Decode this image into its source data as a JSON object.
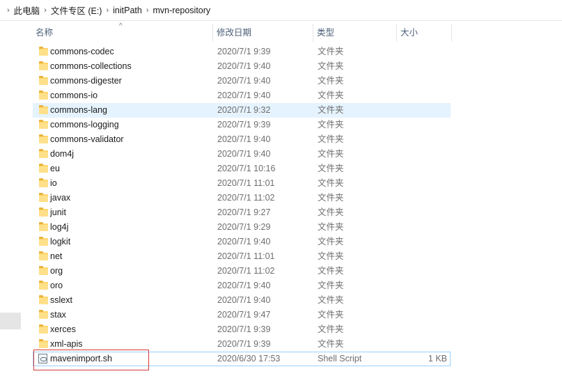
{
  "breadcrumb": [
    "此电脑",
    "文件专区 (E:)",
    "initPath",
    "mvn-repository"
  ],
  "columns": {
    "name": "名称",
    "date": "修改日期",
    "type": "类型",
    "size": "大小"
  },
  "rows": [
    {
      "name": "commons-codec",
      "date": "2020/7/1 9:39",
      "type": "文件夹",
      "size": "",
      "icon": "folder-icon"
    },
    {
      "name": "commons-collections",
      "date": "2020/7/1 9:40",
      "type": "文件夹",
      "size": "",
      "icon": "folder-icon"
    },
    {
      "name": "commons-digester",
      "date": "2020/7/1 9:40",
      "type": "文件夹",
      "size": "",
      "icon": "folder-icon"
    },
    {
      "name": "commons-io",
      "date": "2020/7/1 9:40",
      "type": "文件夹",
      "size": "",
      "icon": "folder-icon"
    },
    {
      "name": "commons-lang",
      "date": "2020/7/1 9:32",
      "type": "文件夹",
      "size": "",
      "icon": "folder-icon"
    },
    {
      "name": "commons-logging",
      "date": "2020/7/1 9:39",
      "type": "文件夹",
      "size": "",
      "icon": "folder-icon"
    },
    {
      "name": "commons-validator",
      "date": "2020/7/1 9:40",
      "type": "文件夹",
      "size": "",
      "icon": "folder-icon"
    },
    {
      "name": "dom4j",
      "date": "2020/7/1 9:40",
      "type": "文件夹",
      "size": "",
      "icon": "folder-icon"
    },
    {
      "name": "eu",
      "date": "2020/7/1 10:16",
      "type": "文件夹",
      "size": "",
      "icon": "folder-icon"
    },
    {
      "name": "io",
      "date": "2020/7/1 11:01",
      "type": "文件夹",
      "size": "",
      "icon": "folder-icon"
    },
    {
      "name": "javax",
      "date": "2020/7/1 11:02",
      "type": "文件夹",
      "size": "",
      "icon": "folder-icon"
    },
    {
      "name": "junit",
      "date": "2020/7/1 9:27",
      "type": "文件夹",
      "size": "",
      "icon": "folder-icon"
    },
    {
      "name": "log4j",
      "date": "2020/7/1 9:29",
      "type": "文件夹",
      "size": "",
      "icon": "folder-icon"
    },
    {
      "name": "logkit",
      "date": "2020/7/1 9:40",
      "type": "文件夹",
      "size": "",
      "icon": "folder-icon"
    },
    {
      "name": "net",
      "date": "2020/7/1 11:01",
      "type": "文件夹",
      "size": "",
      "icon": "folder-icon"
    },
    {
      "name": "org",
      "date": "2020/7/1 11:02",
      "type": "文件夹",
      "size": "",
      "icon": "folder-icon"
    },
    {
      "name": "oro",
      "date": "2020/7/1 9:40",
      "type": "文件夹",
      "size": "",
      "icon": "folder-icon"
    },
    {
      "name": "sslext",
      "date": "2020/7/1 9:40",
      "type": "文件夹",
      "size": "",
      "icon": "folder-icon"
    },
    {
      "name": "stax",
      "date": "2020/7/1 9:47",
      "type": "文件夹",
      "size": "",
      "icon": "folder-icon"
    },
    {
      "name": "xerces",
      "date": "2020/7/1 9:39",
      "type": "文件夹",
      "size": "",
      "icon": "folder-icon"
    },
    {
      "name": "xml-apis",
      "date": "2020/7/1 9:39",
      "type": "文件夹",
      "size": "",
      "icon": "folder-icon"
    },
    {
      "name": "mavenimport.sh",
      "date": "2020/6/30 17:53",
      "type": "Shell Script",
      "size": "1 KB",
      "icon": "shell-script-icon"
    }
  ],
  "state": {
    "hover_row": "commons-lang",
    "selected_row": "mavenimport.sh",
    "sorted_column": "name"
  },
  "colors": {
    "hover_bg": "#e5f3ff",
    "selected_border": "#99d1ff",
    "highlight_box": "#d9383a",
    "header_text": "#4c607a"
  }
}
